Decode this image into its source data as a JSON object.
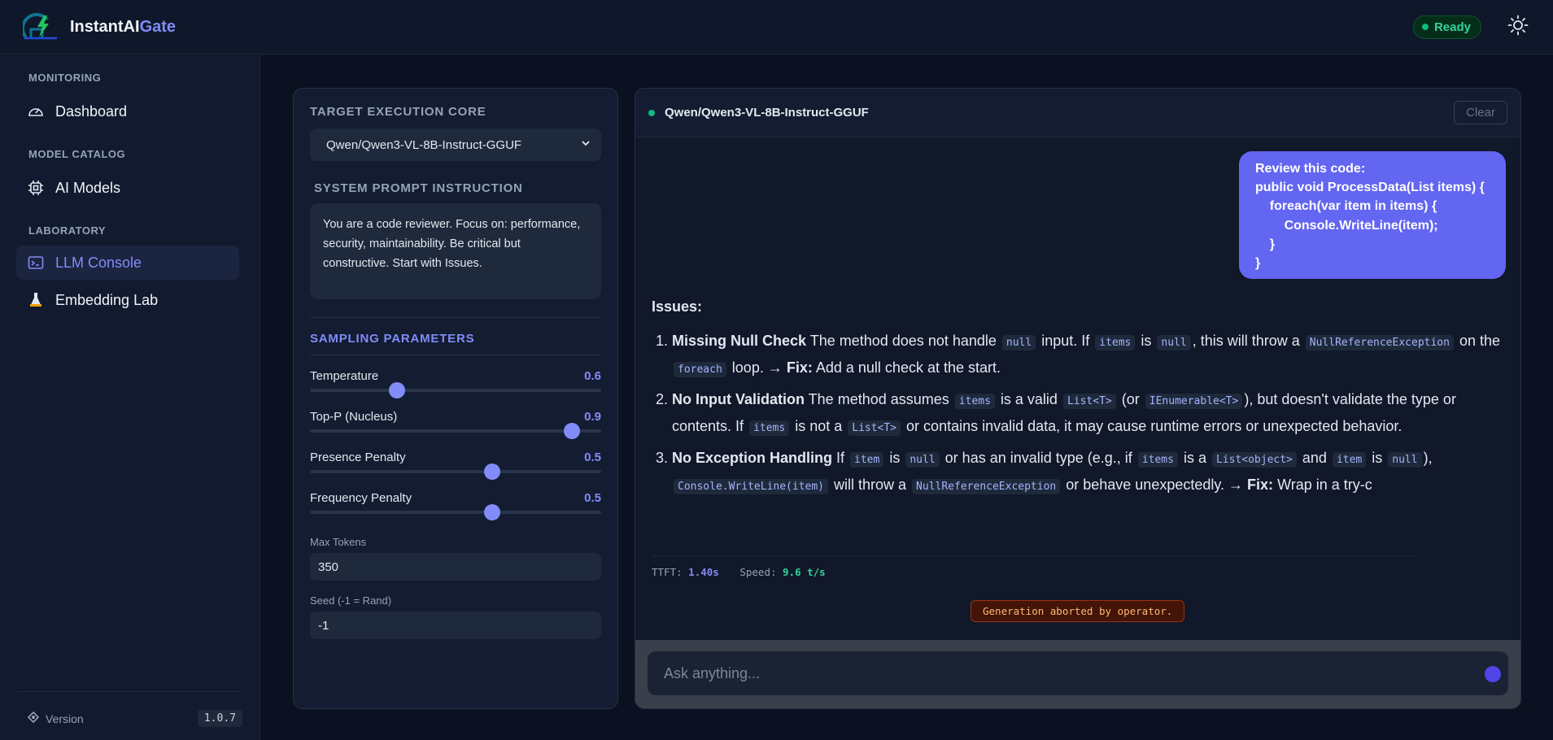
{
  "app": {
    "name_main": "InstantAI",
    "name_accent": "Gate",
    "status": "Ready",
    "theme_icon": "sun-icon",
    "colors": {
      "accent": "#818cf8",
      "bubble": "#6366f1",
      "ok": "#10b981"
    }
  },
  "sidebar": {
    "sections": [
      {
        "title": "MONITORING",
        "items": [
          {
            "label": "Dashboard",
            "icon": "gauge-icon"
          }
        ]
      },
      {
        "title": "MODEL CATALOG",
        "items": [
          {
            "label": "AI Models",
            "icon": "chip-icon"
          }
        ]
      },
      {
        "title": "LABORATORY",
        "items": [
          {
            "label": "LLM Console",
            "icon": "terminal-icon",
            "active": true
          },
          {
            "label": "Embedding Lab",
            "icon": "flask-icon"
          }
        ]
      }
    ],
    "footer": {
      "label": "Version",
      "version": "1.0.7",
      "icon": "diamond-icon"
    }
  },
  "settings": {
    "target_title": "TARGET EXECUTION CORE",
    "target_value": "Qwen/Qwen3-VL-8B-Instruct-GGUF",
    "prompt_title": "SYSTEM PROMPT INSTRUCTION",
    "prompt_text": "You are a code reviewer. Focus on: performance, security, maintainability. Be critical but constructive. Start with Issues.",
    "sampling_title": "SAMPLING PARAMETERS",
    "params": [
      {
        "label": "Temperature",
        "value": "0.6",
        "fraction": 0.3
      },
      {
        "label": "Top-P (Nucleus)",
        "value": "0.9",
        "fraction": 0.9
      },
      {
        "label": "Presence Penalty",
        "value": "0.5",
        "fraction": 0.625
      },
      {
        "label": "Frequency Penalty",
        "value": "0.5",
        "fraction": 0.625
      }
    ],
    "max_tokens_label": "Max Tokens",
    "max_tokens_value": "350",
    "seed_label": "Seed (-1 = Rand)",
    "seed_value": "-1"
  },
  "chat": {
    "model": "Qwen/Qwen3-VL-8B-Instruct-GGUF",
    "clear_label": "Clear",
    "user_message": [
      "Review this code:",
      "public void ProcessData(List items) {",
      "    foreach(var item in items) {",
      "        Console.WriteLine(item);",
      "    }",
      "}"
    ],
    "answer": {
      "heading": "Issues:",
      "items": [
        {
          "num": "1.",
          "parts": [
            {
              "t": "b",
              "v": "Missing Null Check"
            },
            {
              "t": "s",
              "v": " The method does not handle "
            },
            {
              "t": "c",
              "v": "null"
            },
            {
              "t": "s",
              "v": " input. If "
            },
            {
              "t": "c",
              "v": "items"
            },
            {
              "t": "s",
              "v": " is "
            },
            {
              "t": "c",
              "v": "null"
            },
            {
              "t": "s",
              "v": ", this will throw a "
            },
            {
              "t": "c",
              "v": "NullReferenceException"
            },
            {
              "t": "s",
              "v": " on the "
            },
            {
              "t": "c",
              "v": "foreach"
            },
            {
              "t": "s",
              "v": " loop. → "
            },
            {
              "t": "b",
              "v": "Fix:"
            },
            {
              "t": "s",
              "v": " Add a null check at the start."
            }
          ]
        },
        {
          "num": "2.",
          "parts": [
            {
              "t": "b",
              "v": "No Input Validation"
            },
            {
              "t": "s",
              "v": " The method assumes "
            },
            {
              "t": "c",
              "v": "items"
            },
            {
              "t": "s",
              "v": " is a valid "
            },
            {
              "t": "c",
              "v": "List<T>"
            },
            {
              "t": "s",
              "v": " (or "
            },
            {
              "t": "c",
              "v": "IEnumerable<T>"
            },
            {
              "t": "s",
              "v": "), but doesn't validate the type or contents. If "
            },
            {
              "t": "c",
              "v": "items"
            },
            {
              "t": "s",
              "v": " is not a "
            },
            {
              "t": "c",
              "v": "List<T>"
            },
            {
              "t": "s",
              "v": " or contains invalid data, it may cause runtime errors or unexpected behavior."
            }
          ]
        },
        {
          "num": "3.",
          "parts": [
            {
              "t": "b",
              "v": "No Exception Handling"
            },
            {
              "t": "s",
              "v": " If "
            },
            {
              "t": "c",
              "v": "item"
            },
            {
              "t": "s",
              "v": " is "
            },
            {
              "t": "c",
              "v": "null"
            },
            {
              "t": "s",
              "v": " or has an invalid type (e.g., if "
            },
            {
              "t": "c",
              "v": "items"
            },
            {
              "t": "s",
              "v": " is a "
            },
            {
              "t": "c",
              "v": "List<object>"
            },
            {
              "t": "s",
              "v": " and "
            },
            {
              "t": "c",
              "v": "item"
            },
            {
              "t": "s",
              "v": " is "
            },
            {
              "t": "c",
              "v": "null"
            },
            {
              "t": "s",
              "v": "), "
            },
            {
              "t": "c",
              "v": "Console.WriteLine(item)"
            },
            {
              "t": "s",
              "v": " will throw a "
            },
            {
              "t": "c",
              "v": "NullReferenceException"
            },
            {
              "t": "s",
              "v": " or behave unexpectedly. → "
            },
            {
              "t": "b",
              "v": "Fix:"
            },
            {
              "t": "s",
              "v": " Wrap in a try-c"
            }
          ]
        }
      ]
    },
    "ttft_label": "TTFT:",
    "ttft_value": "1.40s",
    "speed_label": "Speed:",
    "speed_value": "9.6 t/s",
    "abort_message": "Generation aborted by operator.",
    "input_placeholder": "Ask anything..."
  }
}
